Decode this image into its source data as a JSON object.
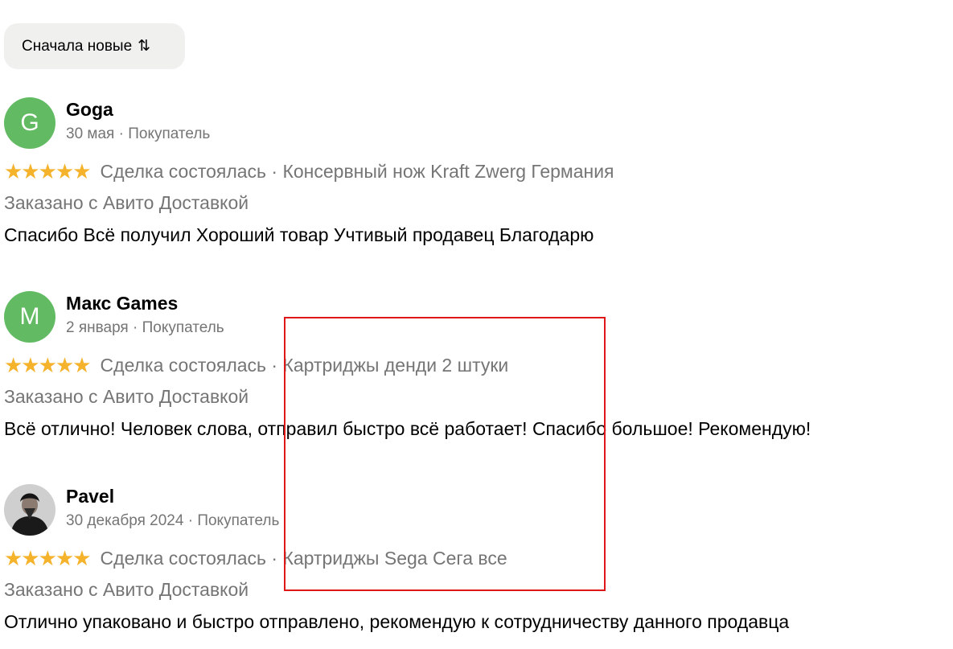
{
  "sort": {
    "label": "Сначала новые",
    "icon": "⇅"
  },
  "reviews": [
    {
      "avatar_letter": "G",
      "author": "Goga",
      "meta": "30 мая · Покупатель",
      "stars": "★★★★★",
      "deal": "Сделка состоялась · Консервный нож Kraft Zwerg Германия",
      "delivery": "Заказано с Авито Доставкой",
      "text": "Спасибо Всё получил Хороший товар Учтивый продавец Благодарю"
    },
    {
      "avatar_letter": "M",
      "author": "Макс Games",
      "meta": "2 января · Покупатель",
      "stars": "★★★★★",
      "deal": "Сделка состоялась · Картриджы денди 2 штуки",
      "delivery": "Заказано с Авито Доставкой",
      "text": "Всё отлично! Человек слова, отправил быстро всё работает! Спасибо большое! Рекомендую!"
    },
    {
      "avatar_letter": "",
      "author": "Pavel",
      "meta": "30 декабря 2024 · Покупатель",
      "stars": "★★★★★",
      "deal": "Сделка состоялась · Картриджы Sega Сега все",
      "delivery": "Заказано с Авито Доставкой",
      "text": "Отлично упаковано и быстро отправлено, рекомендую к сотрудничеству данного продавца"
    }
  ],
  "colors": {
    "star": "#f5b22b",
    "avatar_green": "#62bb63",
    "muted_text": "#757575",
    "highlight": "#e01717",
    "sort_bg": "#f0f0ef"
  }
}
